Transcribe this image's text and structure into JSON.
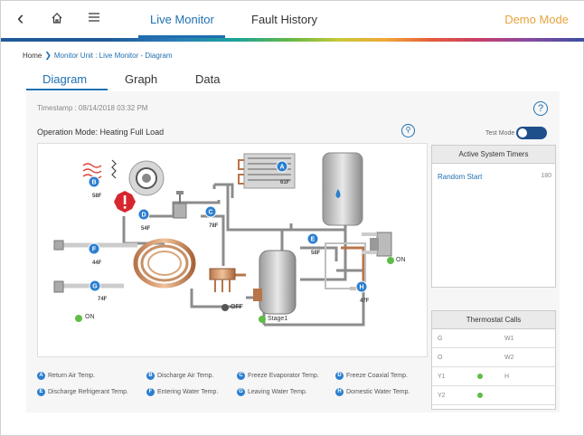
{
  "nav": {
    "back_icon": "chevron-left-icon",
    "home_icon": "home-icon",
    "menu_icon": "hamburger-icon",
    "tabs": [
      {
        "label": "Live Monitor",
        "active": true
      },
      {
        "label": "Fault History",
        "active": false
      }
    ],
    "demo_mode": "Demo Mode",
    "active_color": "#1f6fb0",
    "demo_color": "#e8a33c"
  },
  "breadcrumb": {
    "home": "Home",
    "path": "Monitor Unit : Live Monitor - Diagram"
  },
  "subtabs": [
    {
      "label": "Diagram",
      "active": true
    },
    {
      "label": "Graph",
      "active": false
    },
    {
      "label": "Data",
      "active": false
    }
  ],
  "panel": {
    "timestamp": "Timestamp : 08/14/2018 03:32 PM",
    "operation_mode": "Operation Mode: Heating Full Load",
    "test_mode_label": "Test Mode",
    "test_mode_on": true
  },
  "diagram": {
    "sensors": [
      {
        "id": "A",
        "value": "61F"
      },
      {
        "id": "B",
        "value": "58F"
      },
      {
        "id": "C",
        "value": "78F"
      },
      {
        "id": "D",
        "value": "54F"
      },
      {
        "id": "E",
        "value": "58F"
      },
      {
        "id": "F",
        "value": "44F"
      },
      {
        "id": "G",
        "value": "74F"
      },
      {
        "id": "H",
        "value": "47F"
      }
    ],
    "status_on_left": "ON",
    "status_on_right": "ON",
    "status_off": "OFF",
    "stage": "Stage1"
  },
  "legend": [
    {
      "id": "A",
      "label": "Return Air Temp."
    },
    {
      "id": "B",
      "label": "Discharge Air Temp."
    },
    {
      "id": "C",
      "label": "Freeze Evaporator Temp."
    },
    {
      "id": "D",
      "label": "Freeze Coaxial Temp."
    },
    {
      "id": "E",
      "label": "Discharge Refrigerant Temp."
    },
    {
      "id": "F",
      "label": "Entering Water Temp."
    },
    {
      "id": "G",
      "label": "Leaving Water Temp."
    },
    {
      "id": "H",
      "label": "Domestic Water Temp."
    }
  ],
  "timers": {
    "title": "Active System Timers",
    "rows": [
      {
        "label": "Random Start",
        "value": "180"
      }
    ]
  },
  "thermostat": {
    "title": "Thermostat Calls",
    "rows": [
      {
        "left": "G",
        "left_on": false,
        "right": "W1",
        "right_on": false
      },
      {
        "left": "O",
        "left_on": false,
        "right": "W2",
        "right_on": false
      },
      {
        "left": "Y1",
        "left_on": true,
        "right": "H",
        "right_on": false
      },
      {
        "left": "Y2",
        "left_on": true,
        "right": "",
        "right_on": false
      }
    ]
  }
}
